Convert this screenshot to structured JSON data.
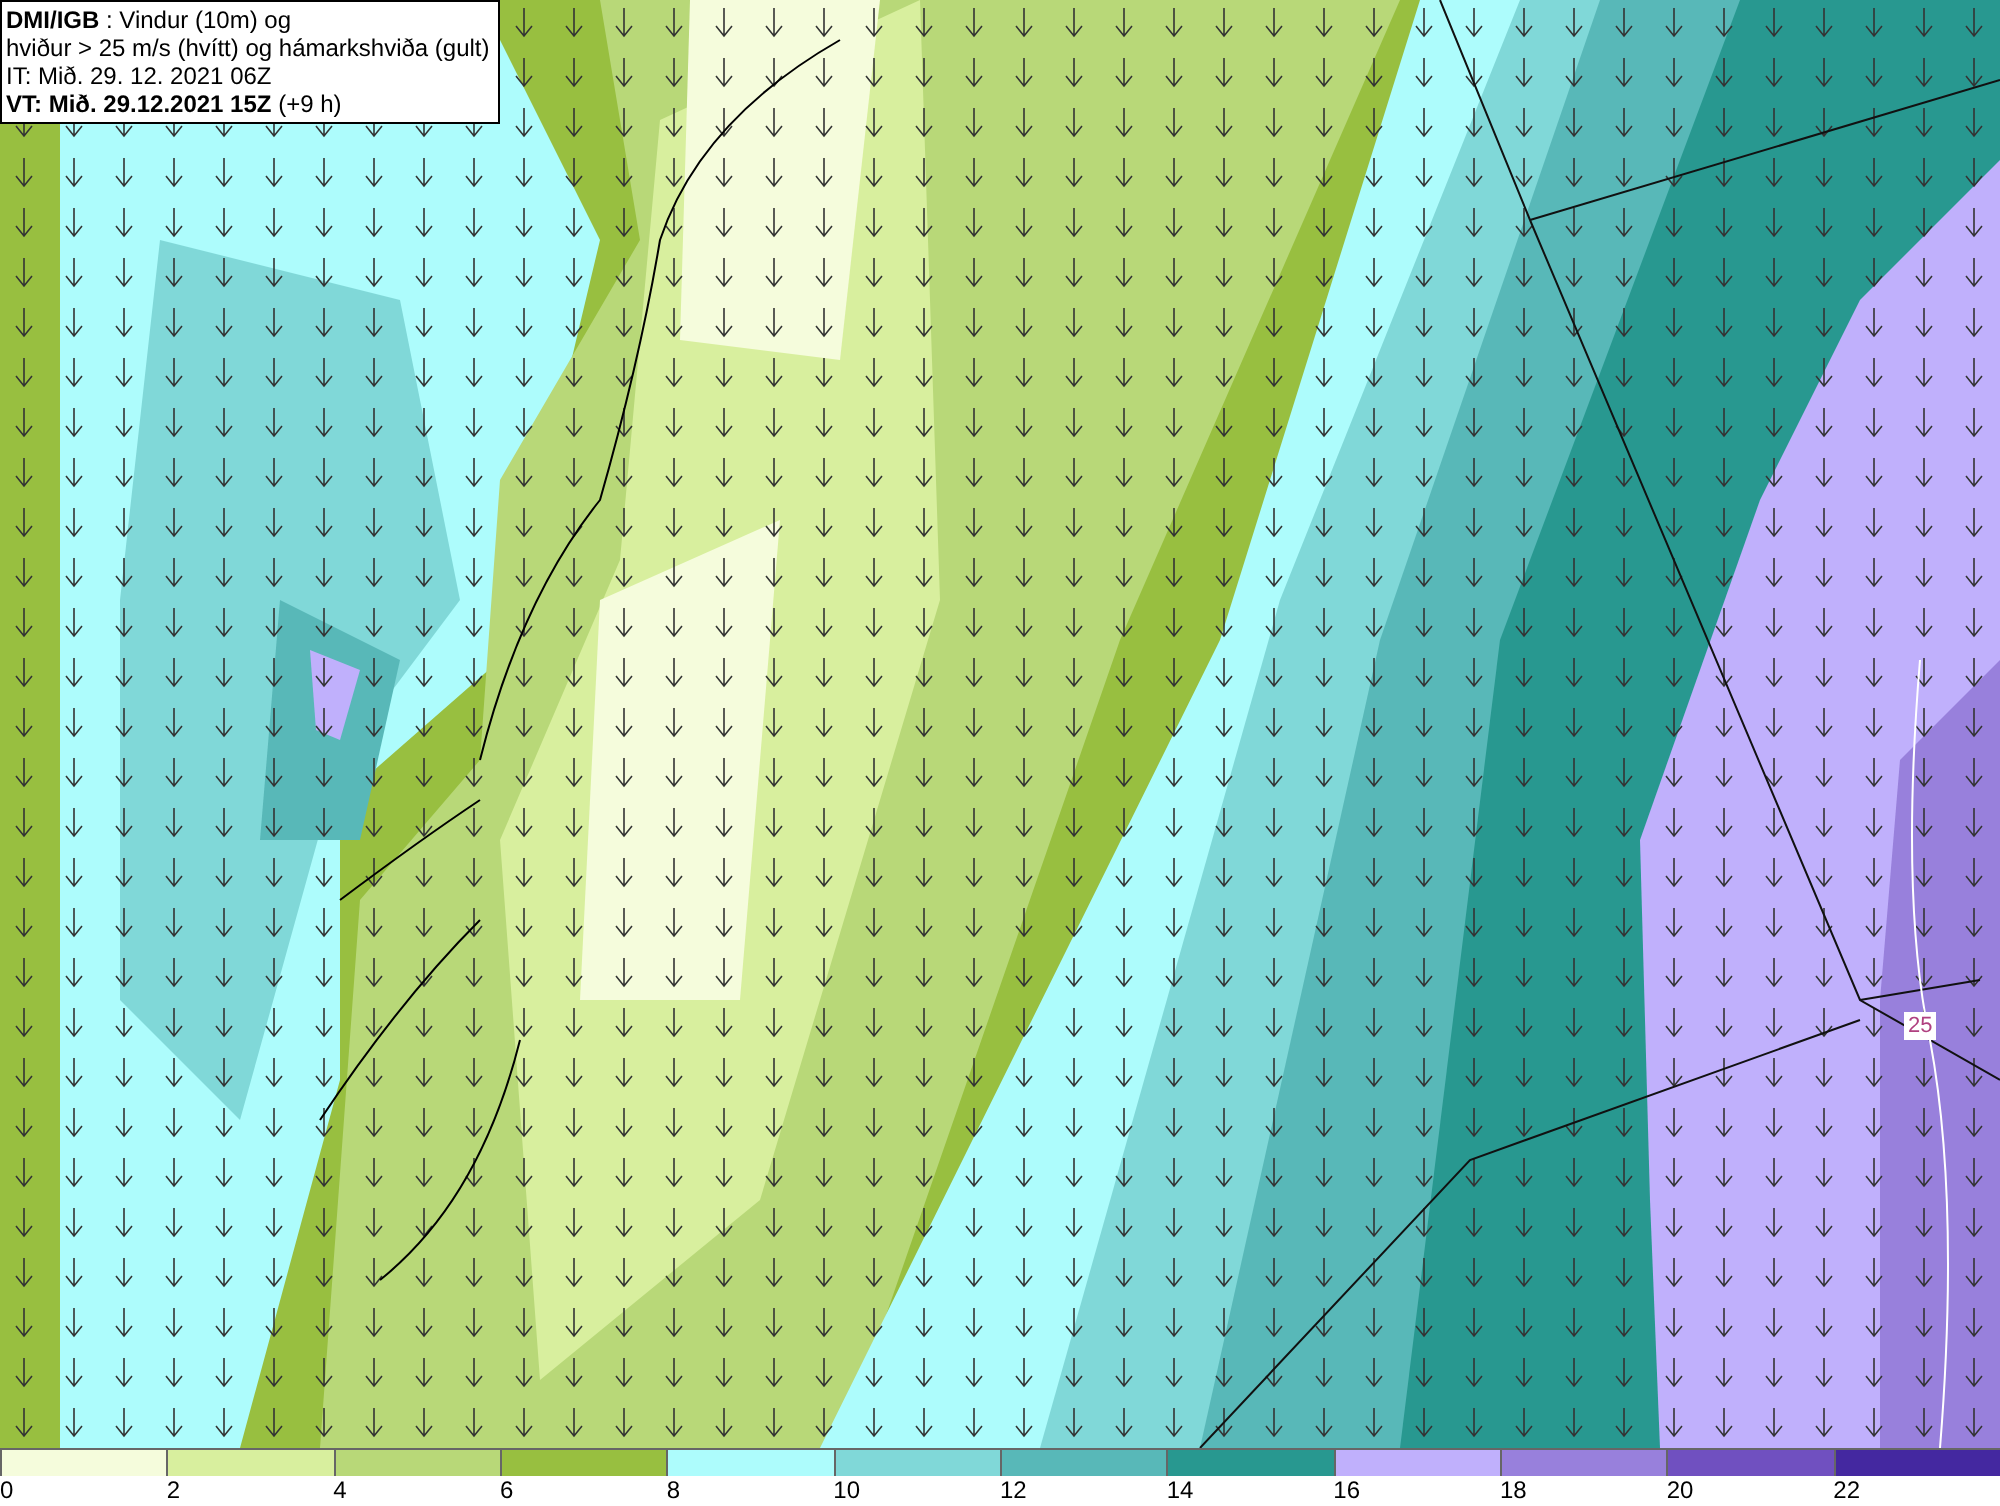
{
  "header": {
    "lines": [
      "**DMI/IGB** : Vindur (10m) og",
      "hviður > 25 m/s (hvítt) og hámarkshviða (gult)",
      "IT: Mið. 29. 12. 2021 06Z",
      "**VT: Mið. 29.12.2021 15Z** (+9 h)"
    ]
  },
  "map": {
    "contour_label": "25"
  },
  "legend": {
    "bins": [
      {
        "color": "#f5fcdc"
      },
      {
        "color": "#d8ef9e"
      },
      {
        "color": "#b8d878"
      },
      {
        "color": "#98bf40"
      },
      {
        "color": "#adfcfc"
      },
      {
        "color": "#80d8d8"
      },
      {
        "color": "#58b8b8"
      },
      {
        "color": "#289890"
      },
      {
        "color": "#c0b0fc"
      },
      {
        "color": "#9880dc"
      },
      {
        "color": "#7050c0"
      },
      {
        "color": "#4428a0"
      }
    ],
    "ticks": [
      "0",
      "2",
      "4",
      "6",
      "8",
      "10",
      "12",
      "14",
      "16",
      "18",
      "20",
      "22"
    ]
  }
}
